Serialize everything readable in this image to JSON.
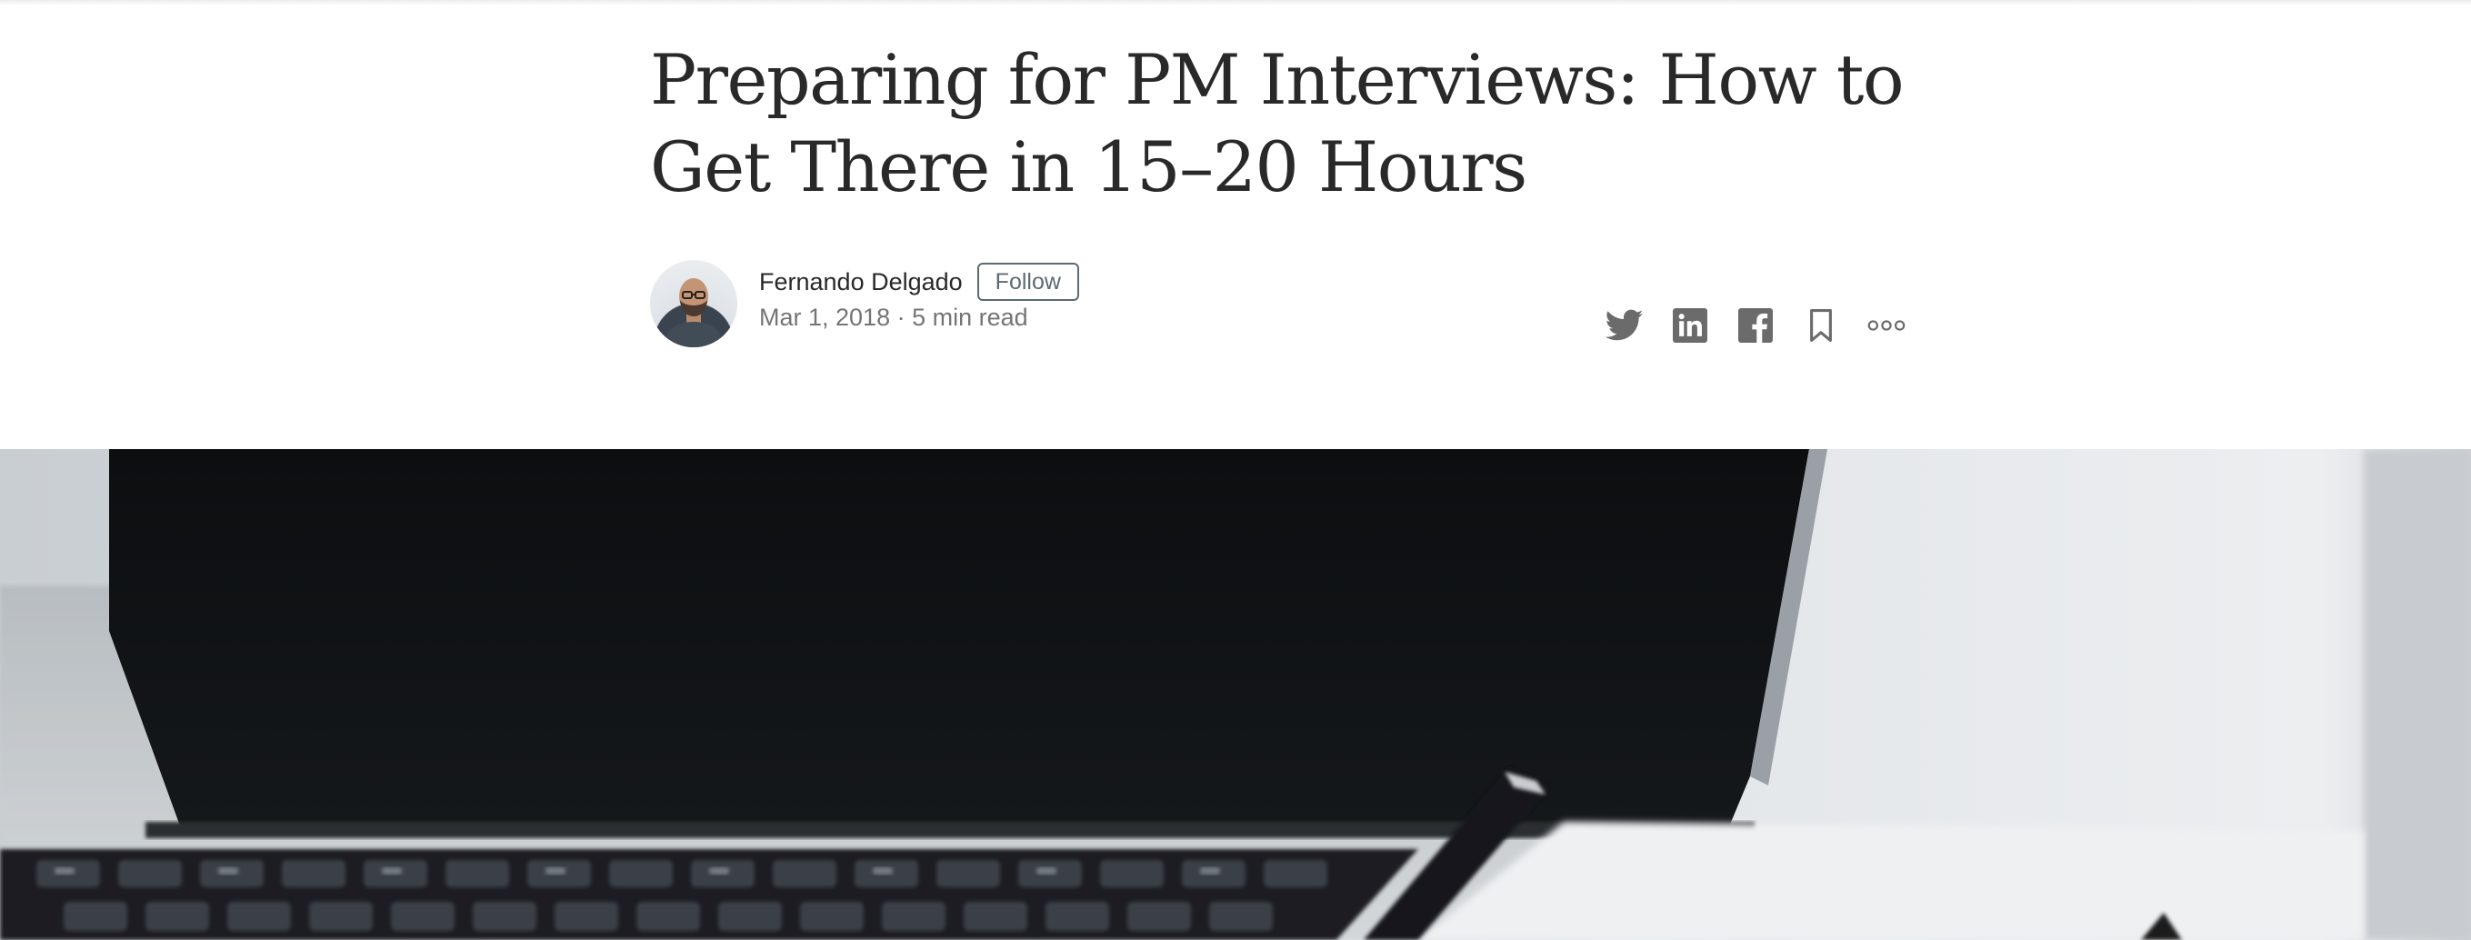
{
  "article": {
    "title_line1": "Preparing for PM Interviews: How to",
    "title_line2": "Get There in 15–20 Hours"
  },
  "author": {
    "name": "Fernando Delgado",
    "follow_label": "Follow",
    "date_and_read": "Mar 1, 2018 · 5 min read"
  },
  "share": {
    "icons": [
      "twitter-icon",
      "linkedin-icon",
      "facebook-icon",
      "bookmark-icon",
      "more-icon"
    ],
    "icon_color": "#6b6b6b"
  },
  "hero_image": {
    "subject": "laptop keyboard with pen"
  }
}
